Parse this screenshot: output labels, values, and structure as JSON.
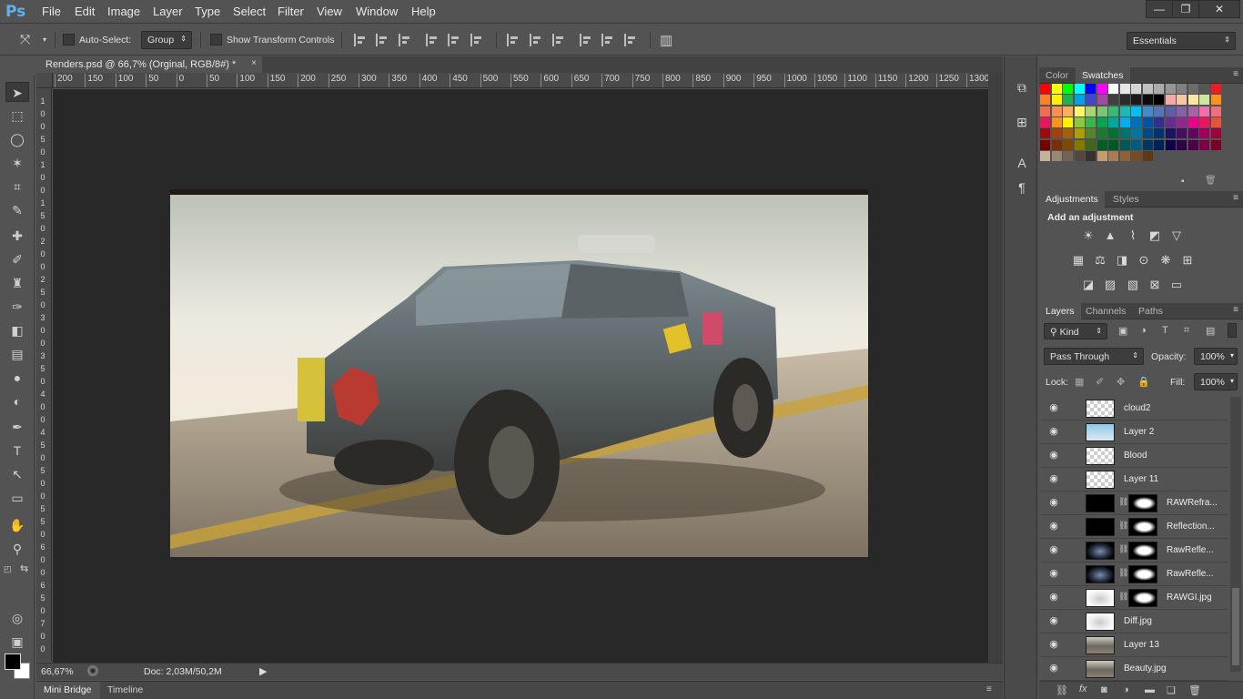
{
  "app": {
    "logo": "Ps"
  },
  "menu": [
    "File",
    "Edit",
    "Image",
    "Layer",
    "Type",
    "Select",
    "Filter",
    "View",
    "Window",
    "Help"
  ],
  "window_controls": {
    "minimize": "—",
    "restore": "❐",
    "close": "✕"
  },
  "options": {
    "auto_select_label": "Auto-Select:",
    "auto_select_value": "Group",
    "show_transform_label": "Show Transform Controls",
    "workspace": "Essentials"
  },
  "document": {
    "tab_title": "Renders.psd @ 66,7% (Orginal, RGB/8#) *",
    "close": "×"
  },
  "ruler": {
    "top": [
      "200",
      "150",
      "100",
      "50",
      "0",
      "50",
      "100",
      "150",
      "200",
      "250",
      "300",
      "350",
      "400",
      "450",
      "500",
      "550",
      "600",
      "650",
      "700",
      "750",
      "800",
      "850",
      "900",
      "950",
      "1000",
      "1050",
      "1100",
      "1150",
      "1200",
      "1250",
      "1300"
    ],
    "left": [
      "1",
      "0",
      "0",
      "5",
      "0",
      "1",
      "0",
      "0",
      "1",
      "5",
      "0",
      "2",
      "0",
      "0",
      "2",
      "5",
      "0",
      "3",
      "0",
      "0",
      "3",
      "5",
      "0",
      "4",
      "0",
      "0",
      "4",
      "5",
      "0",
      "5",
      "0",
      "0",
      "5",
      "5",
      "0",
      "6",
      "0",
      "0",
      "6",
      "5",
      "0",
      "7",
      "0",
      "0"
    ]
  },
  "status": {
    "zoom": "66,67%",
    "doc": "Doc: 2,03M/50,2M"
  },
  "bottom_tabs": [
    "Mini Bridge",
    "Timeline"
  ],
  "color_panel": {
    "tabs": [
      "Color",
      "Swatches"
    ]
  },
  "adjustments": {
    "tabs": [
      "Adjustments",
      "Styles"
    ],
    "heading": "Add an adjustment"
  },
  "layers_panel": {
    "tabs": [
      "Layers",
      "Channels",
      "Paths"
    ],
    "filter_kind": "Kind",
    "blend_mode": "Pass Through",
    "opacity_label": "Opacity:",
    "opacity_value": "100%",
    "lock_label": "Lock:",
    "fill_label": "Fill:",
    "fill_value": "100%",
    "layers": [
      {
        "name": "cloud2",
        "has_mask": false
      },
      {
        "name": "Layer 2",
        "has_mask": false
      },
      {
        "name": "Blood",
        "has_mask": false
      },
      {
        "name": "Layer 11",
        "has_mask": false
      },
      {
        "name": "RAWRefra...",
        "has_mask": true
      },
      {
        "name": "Reflection...",
        "has_mask": true
      },
      {
        "name": "RawRefle...",
        "has_mask": true
      },
      {
        "name": "RawRefle...",
        "has_mask": true
      },
      {
        "name": "RAWGI.jpg",
        "has_mask": true
      },
      {
        "name": "Diff.jpg",
        "has_mask": false
      },
      {
        "name": "Layer 13",
        "has_mask": false
      },
      {
        "name": "Beauty.jpg",
        "has_mask": false
      }
    ]
  },
  "colors": {
    "swatches": [
      "#ff0000",
      "#ffff00",
      "#00ff00",
      "#00ffff",
      "#0000ff",
      "#ff00ff",
      "#ffffff",
      "#e6e6e6",
      "#d4d4d4",
      "#c0c0c0",
      "#ababab",
      "#969696",
      "#808080",
      "#6b6b6b",
      "#565656",
      "#ed1c24",
      "#ff7f27",
      "#fff200",
      "#22b14c",
      "#00a2e8",
      "#3f48cc",
      "#a349a4",
      "#404040",
      "#2b2b2b",
      "#1a1a1a",
      "#0d0d0d",
      "#000000",
      "#f5a9a9",
      "#f7c6a3",
      "#fbe69f",
      "#c9e6a1",
      "#f7941d",
      "#f26c4f",
      "#f68e56",
      "#fbaf5c",
      "#fff568",
      "#acd373",
      "#7cc576",
      "#3bb878",
      "#1abbb4",
      "#00bff3",
      "#438ccb",
      "#5574b9",
      "#605ca8",
      "#855fa8",
      "#a763a8",
      "#f06ea9",
      "#f26d7d",
      "#ed145b",
      "#f7941d",
      "#fff200",
      "#8dc63f",
      "#39b54a",
      "#00a651",
      "#00a99d",
      "#00aeef",
      "#0072bc",
      "#0054a6",
      "#2e3192",
      "#662d91",
      "#92278f",
      "#ec008c",
      "#ed145b",
      "#e8513a",
      "#9e0b0f",
      "#a0410d",
      "#a36209",
      "#aba000",
      "#598527",
      "#1a7b30",
      "#007236",
      "#00746b",
      "#0076a3",
      "#004b80",
      "#003471",
      "#1b1464",
      "#440e62",
      "#630460",
      "#9e005d",
      "#9e0039",
      "#790000",
      "#7b2e00",
      "#7d4900",
      "#827b00",
      "#406618",
      "#005e20",
      "#005826",
      "#005952",
      "#005b7f",
      "#003663",
      "#002157",
      "#0d004c",
      "#32004b",
      "#4b0049",
      "#7b0046",
      "#7a0026",
      "#c7b299",
      "#998675",
      "#736357",
      "#534741",
      "#37302d",
      "#c69c6d",
      "#a67c52",
      "#8c6239",
      "#754c24",
      "#603913"
    ]
  }
}
